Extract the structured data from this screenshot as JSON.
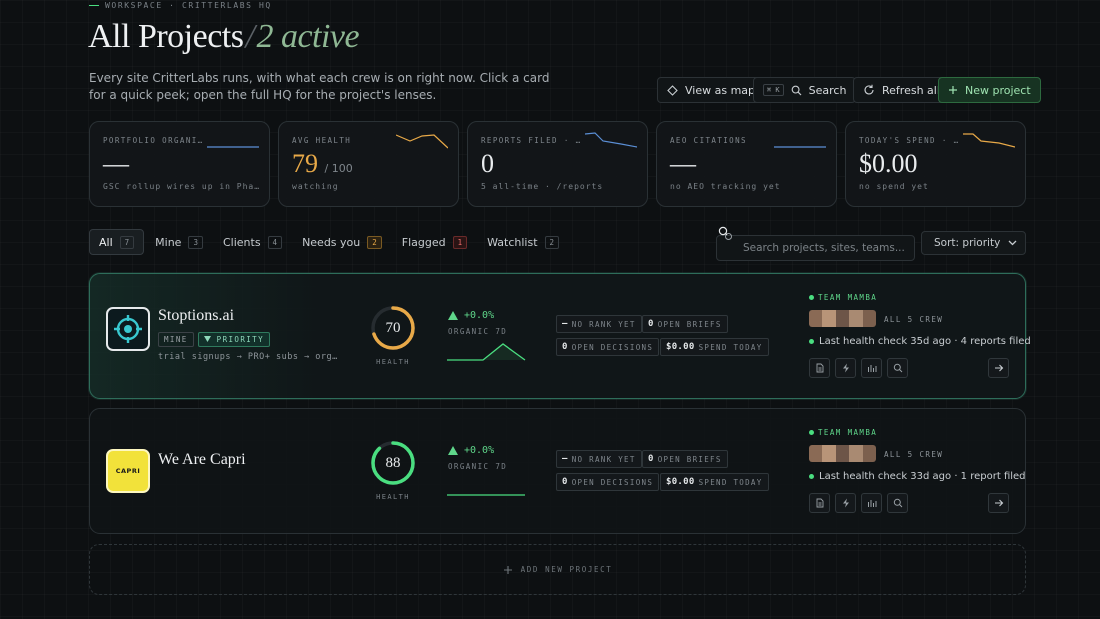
{
  "breadcrumb": "WORKSPACE · CRITTERLABS HQ",
  "title": {
    "main": "All Projects",
    "slash": "/",
    "active": "2 active"
  },
  "subtitle": "Every site CritterLabs runs, with what each crew is on right now. Click a card for a quick peek; open the full HQ for the project's lenses.",
  "toolbar": {
    "view_map": "View as map",
    "kbd": "⌘ K",
    "search": "Search",
    "refresh": "Refresh all",
    "new_project": "New project"
  },
  "stats": [
    {
      "label": "PORTFOLIO ORGANIC…",
      "value": "—",
      "denominator": "",
      "note": "GSC rollup wires up in Pha…",
      "spark_color": "#5b8fd6"
    },
    {
      "label": "AVG HEALTH",
      "value": "79",
      "denominator": "/ 100",
      "note": "watching",
      "spark_color": "#e8a948"
    },
    {
      "label": "REPORTS FILED · T…",
      "value": "0",
      "denominator": "",
      "note": "5 all-time · /reports",
      "spark_color": "#5b8fd6"
    },
    {
      "label": "AEO CITATIONS",
      "value": "—",
      "denominator": "",
      "note": "no AEO tracking yet",
      "spark_color": "#5b8fd6"
    },
    {
      "label": "TODAY'S SPEND · A…",
      "value": "$0.00",
      "denominator": "",
      "note": "no spend yet",
      "spark_color": "#e8a948"
    }
  ],
  "filters": [
    {
      "label": "All",
      "count": "7"
    },
    {
      "label": "Mine",
      "count": "3"
    },
    {
      "label": "Clients",
      "count": "4"
    },
    {
      "label": "Needs you",
      "count": "2"
    },
    {
      "label": "Flagged",
      "count": "1"
    },
    {
      "label": "Watchlist",
      "count": "2"
    }
  ],
  "search": {
    "placeholder": "Search projects, sites, teams..."
  },
  "sort": {
    "selected": "Sort: priority"
  },
  "projects": [
    {
      "name": "Stoptions.ai",
      "tags": [
        "MINE",
        "PRIORITY"
      ],
      "goal": "trial signups → PRO+ subs → org…",
      "health": "70",
      "health_value": 70,
      "health_color": "#e8a948",
      "health_label": "HEALTH",
      "delta": "+0.0%",
      "delta_label": "ORGANIC 7D",
      "kpis": {
        "rank_icon": "—",
        "rank": "NO RANK YET",
        "briefs_n": "0",
        "briefs": "OPEN BRIEFS",
        "decisions_n": "0",
        "decisions": "OPEN DECISIONS",
        "spend_n": "$0.00",
        "spend": "SPEND TODAY"
      },
      "team": "TEAM MAMBA",
      "crew": "ALL 5 CREW",
      "health_check": "Last health check 35d ago · 4 reports filed"
    },
    {
      "name": "We Are Capri",
      "logo_text": "CAPRI",
      "tags": [],
      "goal": "",
      "health": "88",
      "health_value": 88,
      "health_color": "#4ade80",
      "health_label": "HEALTH",
      "delta": "+0.0%",
      "delta_label": "ORGANIC 7D",
      "kpis": {
        "rank_icon": "—",
        "rank": "NO RANK YET",
        "briefs_n": "0",
        "briefs": "OPEN BRIEFS",
        "decisions_n": "0",
        "decisions": "OPEN DECISIONS",
        "spend_n": "$0.00",
        "spend": "SPEND TODAY"
      },
      "team": "TEAM MAMBA",
      "crew": "ALL 5 CREW",
      "health_check": "Last health check 33d ago · 1 report filed"
    }
  ],
  "add_new": "ADD NEW PROJECT",
  "colors": {
    "accent": "#4ade80",
    "amber": "#e8a948",
    "blue": "#5b8fd6",
    "red": "#ef6b6b"
  }
}
